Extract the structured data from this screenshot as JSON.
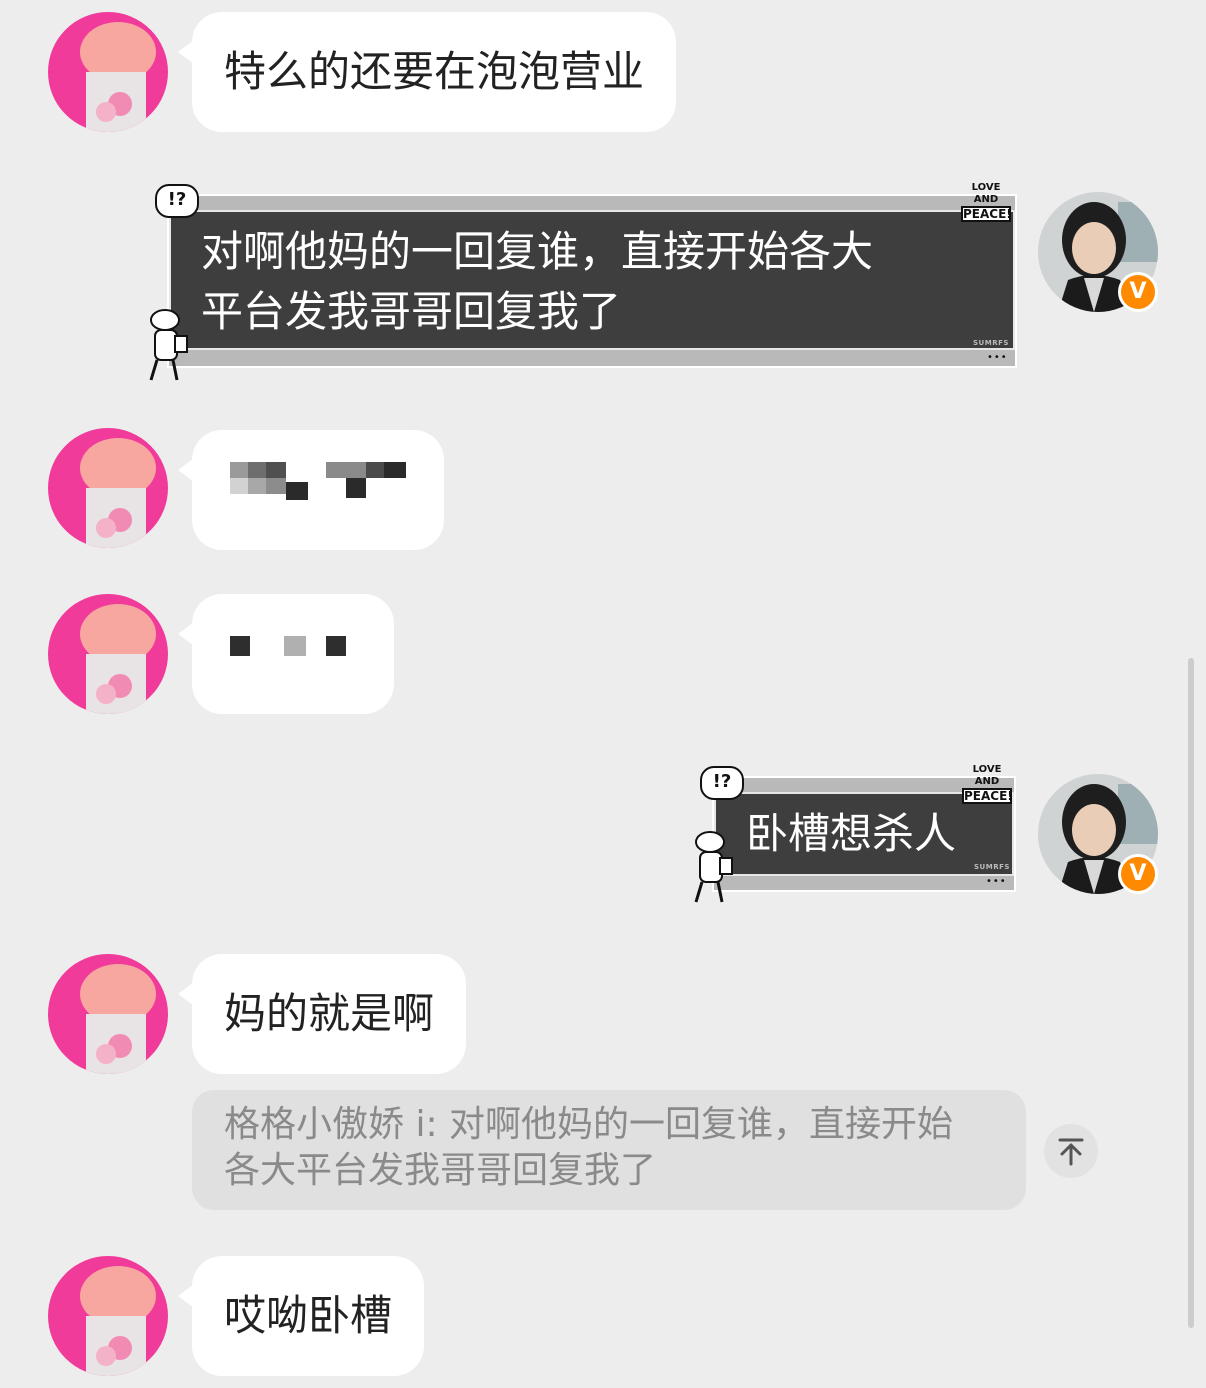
{
  "messages": [
    {
      "sender": "left",
      "text": "特么的还要在泡泡营业"
    },
    {
      "sender": "right",
      "lines": [
        "对啊他妈的一回复谁，直接开始各大",
        "平台发我哥哥回复我了"
      ]
    },
    {
      "sender": "left",
      "text": "",
      "censored": true
    },
    {
      "sender": "left",
      "text": "",
      "censored": true
    },
    {
      "sender": "right",
      "lines": [
        "卧槽想杀人"
      ]
    },
    {
      "sender": "left",
      "text": "妈的就是啊"
    },
    {
      "sender": "left",
      "text": "哎呦卧槽"
    }
  ],
  "quote": {
    "lines": [
      "格格小傲娇 i: 对啊他妈的一回复谁，直接开始",
      "各大平台发我哥哥回复我了"
    ]
  },
  "deco": {
    "top_left": "!?",
    "peace_small": "LOVE AND",
    "peace_big": "PEACE!",
    "signature": "SUMRFS",
    "dots": "•••"
  },
  "icons": {
    "badge": "V",
    "scroll_to_top": "arrow-up-to-top-icon"
  },
  "colors": {
    "background": "#ededed",
    "bubble": "#ffffff",
    "dark_bubble": "#3e3e3e",
    "quote": "#e0e0e0",
    "badge": "#ff8a00"
  }
}
